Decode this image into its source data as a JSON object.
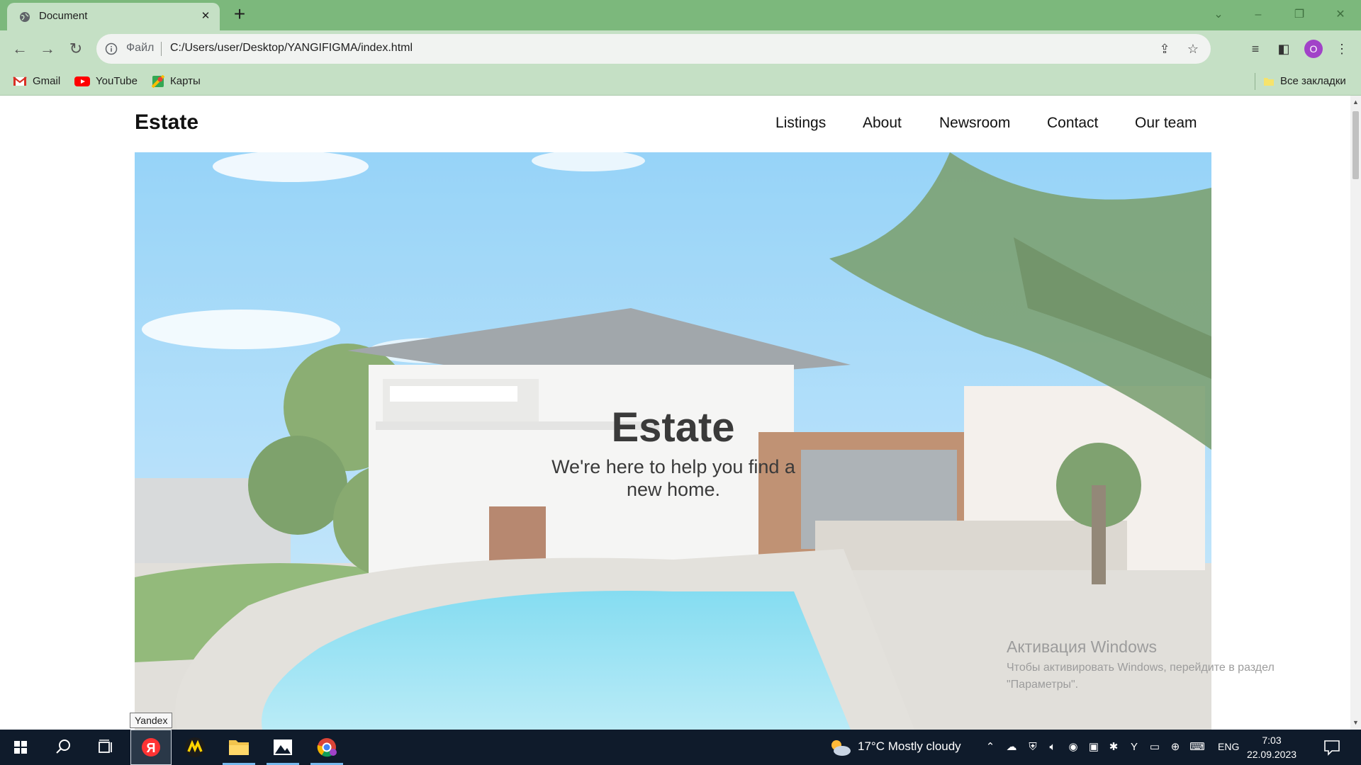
{
  "browser": {
    "tab_title": "Document",
    "tab_close": "✕",
    "new_tab": "+",
    "address_prefix": "Файл",
    "address_url": "C:/Users/user/Desktop/YANGIFIGMA/index.html",
    "profile_initial": "O",
    "bookmarks": [
      "Gmail",
      "YouTube",
      "Карты"
    ],
    "all_bookmarks": "Все закладки"
  },
  "site": {
    "logo": "Estate",
    "nav": [
      "Listings",
      "About",
      "Newsroom",
      "Contact",
      "Our team"
    ],
    "hero_title": "Estate",
    "hero_subtitle": "We're here to help you find a new home."
  },
  "watermark": {
    "title": "Активация Windows",
    "text": "Чтобы активировать Windows, перейдите в раздел \"Параметры\"."
  },
  "tooltip": "Yandex",
  "taskbar": {
    "weather": "17°C  Mostly cloudy",
    "language": "ENG",
    "time": "7:03",
    "date": "22.09.2023"
  },
  "colors": {
    "titlebar": "#7cb87c",
    "toolbar": "#c5e0c5",
    "taskbar": "#0f1b2b",
    "profile": "#a142c8"
  }
}
